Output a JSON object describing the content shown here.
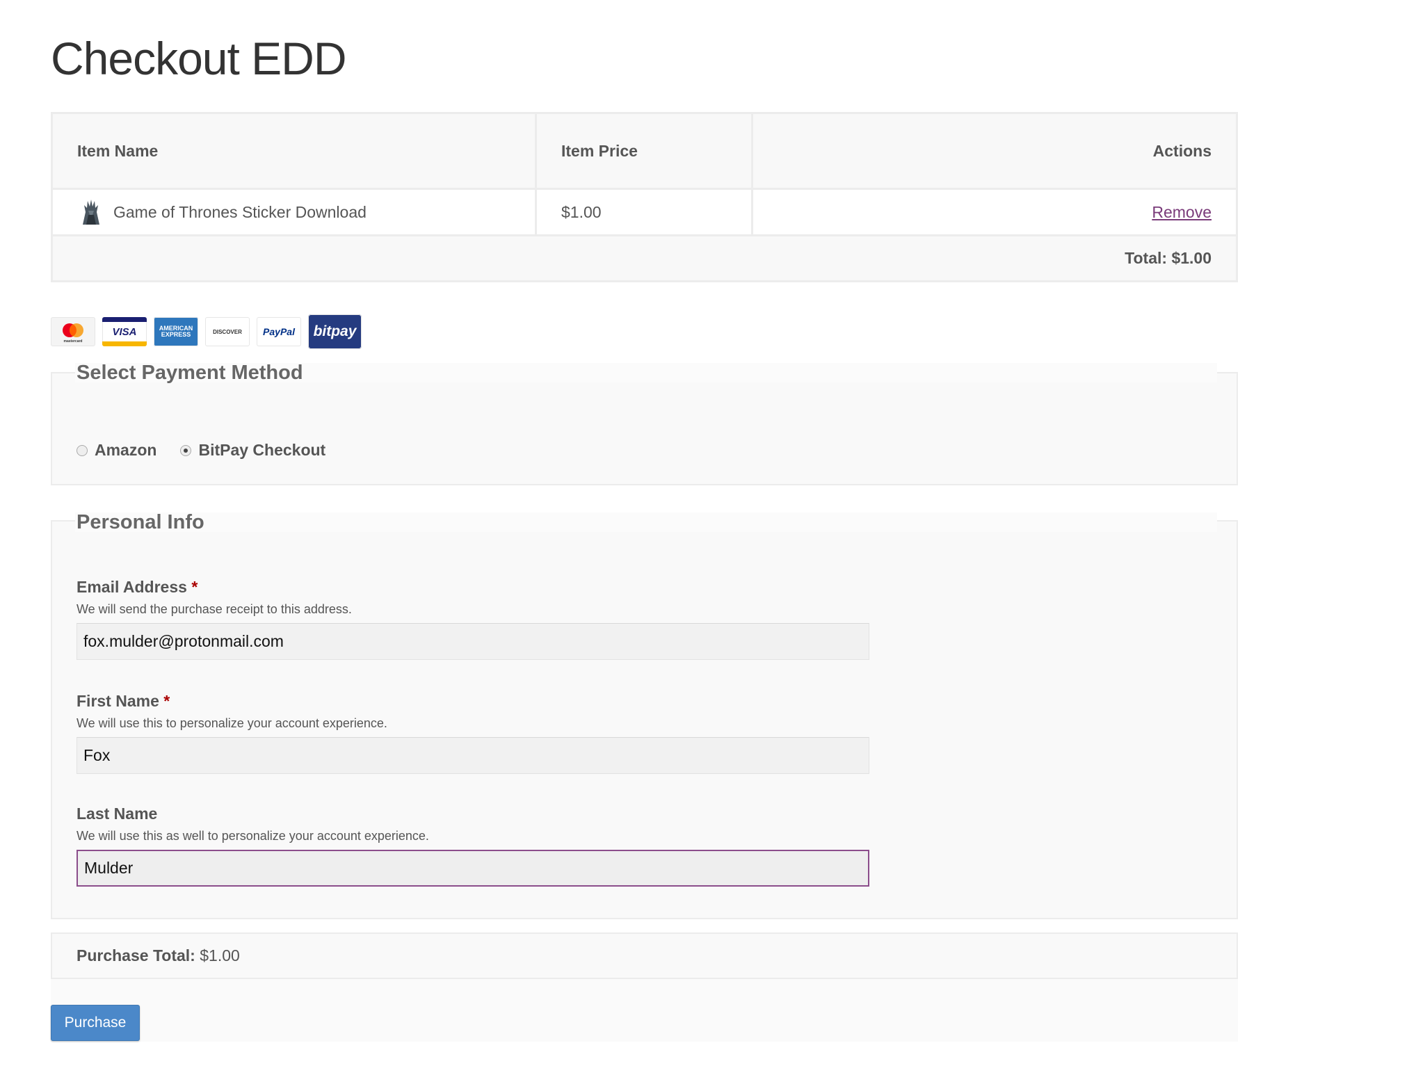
{
  "page": {
    "title": "Checkout EDD"
  },
  "cart": {
    "headers": {
      "item_name": "Item Name",
      "item_price": "Item Price",
      "actions": "Actions"
    },
    "items": [
      {
        "name": "Game of Thrones Sticker Download",
        "price": "$1.00",
        "action": "Remove",
        "thumb_icon": "iron-throne-thumbnail"
      }
    ],
    "total": "Total: $1.00"
  },
  "payment_icons": [
    {
      "name": "mastercard",
      "label": "mastercard"
    },
    {
      "name": "visa",
      "label": "VISA"
    },
    {
      "name": "amex",
      "label": "AMERICAN EXPRESS"
    },
    {
      "name": "discover",
      "label": "DISCOVER"
    },
    {
      "name": "paypal",
      "label": "PayPal"
    },
    {
      "name": "bitpay",
      "label": "bitpay"
    }
  ],
  "payment": {
    "legend": "Select Payment Method",
    "options": [
      {
        "label": "Amazon",
        "checked": false
      },
      {
        "label": "BitPay Checkout",
        "checked": true
      }
    ]
  },
  "personal": {
    "legend": "Personal Info",
    "email": {
      "label": "Email Address",
      "required": "*",
      "description": "We will send the purchase receipt to this address.",
      "value": "fox.mulder@protonmail.com"
    },
    "first_name": {
      "label": "First Name",
      "required": "*",
      "description": "We will use this to personalize your account experience.",
      "value": "Fox"
    },
    "last_name": {
      "label": "Last Name",
      "description": "We will use this as well to personalize your account experience.",
      "value": "Mulder"
    }
  },
  "summary": {
    "label": "Purchase Total:",
    "value": "$1.00"
  },
  "purchase_button": "Purchase",
  "colors": {
    "link": "#7a3b7a",
    "button": "#4b88c9",
    "focus_border": "#8b4d8b",
    "required": "#aa0000"
  }
}
